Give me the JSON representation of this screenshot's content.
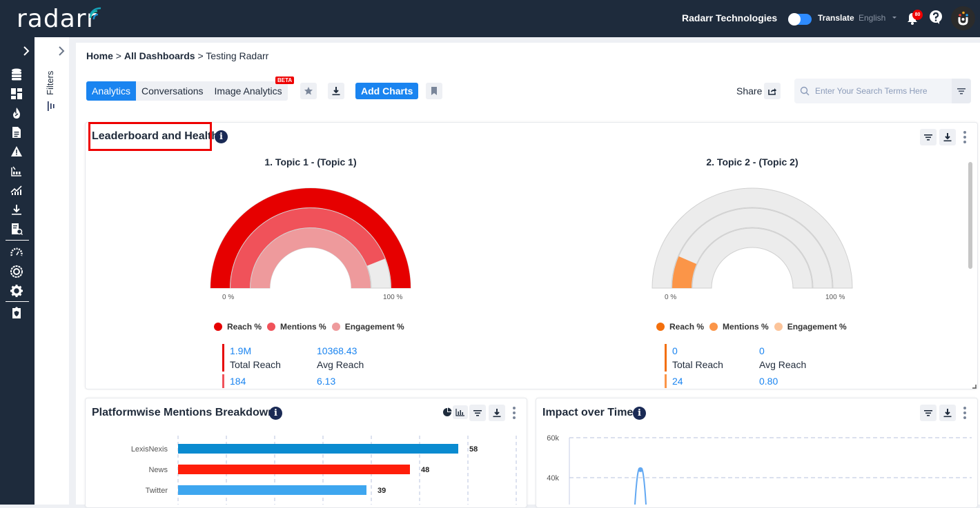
{
  "header": {
    "logo": "radarr",
    "company": "Radarr Technologies",
    "translate_label": "Translate",
    "language": "English",
    "notification_count": "80",
    "translate_enabled": true
  },
  "sidebar": {
    "icons": [
      "expand-icon",
      "database-icon",
      "dashboard-icon",
      "trending-icon",
      "document-icon",
      "alert-icon",
      "reports-icon",
      "analytics-icon",
      "download-icon",
      "search-report-icon",
      "gauge-icon",
      "target-icon",
      "settings-icon",
      "shield-document-icon"
    ]
  },
  "filters": {
    "label": "Filters"
  },
  "breadcrumb": {
    "home": "Home",
    "sep1": " > ",
    "dashboards": "All Dashboards",
    "sep2": " > ",
    "current": "Testing Radarr"
  },
  "tabs": [
    {
      "label": "Analytics",
      "active": true
    },
    {
      "label": "Conversations",
      "active": false
    },
    {
      "label": "Image Analytics",
      "active": false,
      "badge": "BETA"
    }
  ],
  "toolbar": {
    "add_charts": "Add Charts",
    "share": "Share"
  },
  "search": {
    "placeholder": "Enter Your Search Terms Here",
    "value": ""
  },
  "leaderboard": {
    "title": "Leaderboard and Health",
    "topics": [
      {
        "title": "1. Topic 1 - (Topic 1)",
        "axis_min": "0 %",
        "axis_max": "100 %",
        "colors": {
          "reach": "#e60000",
          "mentions": "#f0525a",
          "engagement": "#ee9a9c"
        },
        "values": {
          "reach_pct": 100,
          "mentions_pct": 88,
          "engagement_pct": 100
        },
        "legend": [
          "Reach %",
          "Mentions %",
          "Engagement %"
        ],
        "stats": [
          {
            "value": "1.9M",
            "label": "Total Reach",
            "value2": "10368.43",
            "label2": "Avg Reach"
          },
          {
            "value": "184",
            "value2": "6.13"
          }
        ]
      },
      {
        "title": "2. Topic 2 - (Topic 2)",
        "axis_min": "0 %",
        "axis_max": "100 %",
        "colors": {
          "reach": "#f36f0c",
          "mentions": "#fb9548",
          "engagement": "#fcc49a"
        },
        "values": {
          "reach_pct": 0,
          "mentions_pct": 13,
          "engagement_pct": 0
        },
        "legend": [
          "Reach %",
          "Mentions %",
          "Engagement %"
        ],
        "stats": [
          {
            "value": "0",
            "label": "Total Reach",
            "value2": "0",
            "label2": "Avg Reach"
          },
          {
            "value": "24",
            "value2": "0.80"
          }
        ]
      }
    ]
  },
  "platformwise": {
    "title": "Platformwise Mentions Breakdown",
    "chart_data": {
      "type": "bar",
      "orientation": "horizontal",
      "categories": [
        "LexisNexis",
        "News",
        "Twitter"
      ],
      "values": [
        58,
        48,
        39
      ],
      "colors": [
        "#0a8bd0",
        "#ff1e0a",
        "#3ea6ef"
      ],
      "xlim": [
        0,
        70
      ]
    }
  },
  "impact": {
    "title": "Impact over Time",
    "chart_data": {
      "type": "line",
      "y_ticks": [
        "60k",
        "40k"
      ],
      "ylim": [
        0,
        60000
      ],
      "peak_value": 44000,
      "color": "#62a8f2"
    }
  }
}
